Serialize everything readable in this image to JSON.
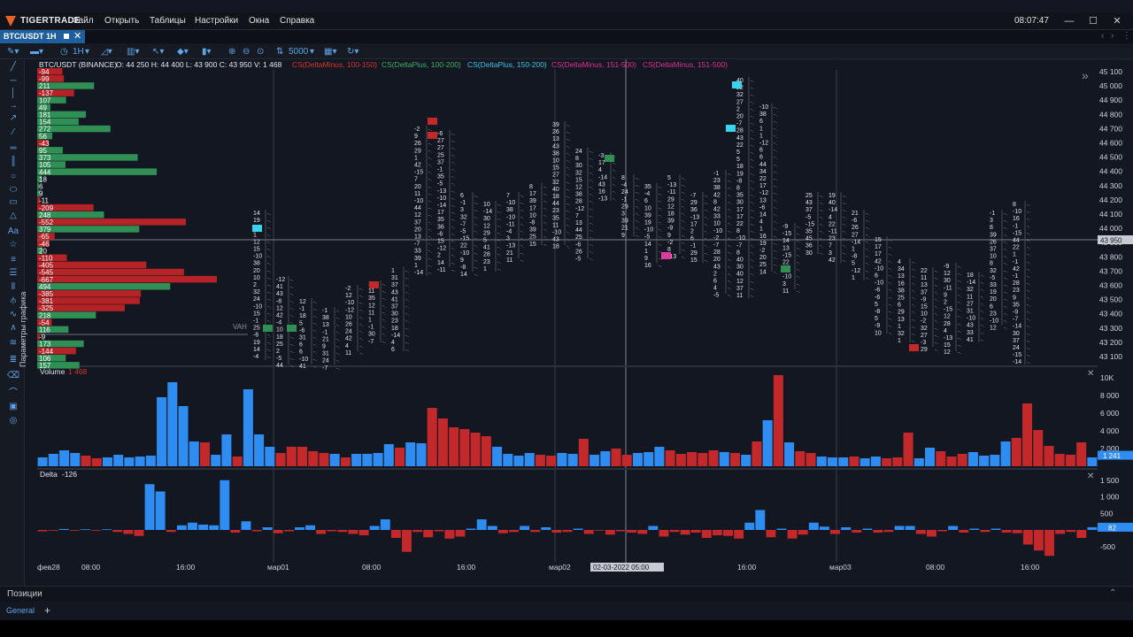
{
  "app": {
    "brand": "TIGERTRADE",
    "time": "08:07:47",
    "menu": [
      "Файл",
      "Открыть",
      "Таблицы",
      "Настройки",
      "Окна",
      "Справка"
    ]
  },
  "tab": {
    "label": "BTC/USDT 1H"
  },
  "toolbar": {
    "timeframe": "1H",
    "depth": "5000"
  },
  "side_label": "Параметры графика",
  "chart_header": {
    "symbol": "BTC/USDT (BINANCE)",
    "ohlc": "O: 44 250  H: 44 400  L: 43 900  C: 43 950  V: 1 468",
    "filters": [
      {
        "text": "CS(DeltaMinus, 100-150)",
        "color": "#d9342b"
      },
      {
        "text": "CS(DeltaPlus, 100-200)",
        "color": "#3fae61"
      },
      {
        "text": "CS(DeltaPlus, 150-200)",
        "color": "#39c4e0"
      },
      {
        "text": "CS(DeltaMinus, 151-500)",
        "color": "#e0308e"
      },
      {
        "text": "CS(DeltaMinus, 151-500)",
        "color": "#e0308e"
      }
    ]
  },
  "colors": {
    "up": "#2f8cf0",
    "down": "#c3282b",
    "profile_pos": "#2f8f54",
    "profile_neg": "#b62327",
    "cyan": "#3ad3ee",
    "magenta": "#e03a9c",
    "grid": "#2a2e38"
  },
  "price_axis": {
    "ticks": [
      "45 100",
      "45 000",
      "44 900",
      "44 800",
      "44 700",
      "44 600",
      "44 500",
      "44 400",
      "44 300",
      "44 200",
      "44 100",
      "44 000",
      "43 900",
      "43 800",
      "43 700",
      "43 600",
      "43 500",
      "43 400",
      "43 300",
      "43 200",
      "43 100"
    ],
    "current": "43 950"
  },
  "profile": {
    "label_vah": "VAH",
    "rows": [
      {
        "v": "-94"
      },
      {
        "v": "-99"
      },
      {
        "v": "211"
      },
      {
        "v": "-137"
      },
      {
        "v": "107"
      },
      {
        "v": "49"
      },
      {
        "v": "181"
      },
      {
        "v": "154"
      },
      {
        "v": "272"
      },
      {
        "v": "56"
      },
      {
        "v": "-43"
      },
      {
        "v": "95"
      },
      {
        "v": "373"
      },
      {
        "v": "105"
      },
      {
        "v": "444"
      },
      {
        "v": "18"
      },
      {
        "v": "6"
      },
      {
        "v": "9"
      },
      {
        "v": "-11"
      },
      {
        "v": "-209"
      },
      {
        "v": "248"
      },
      {
        "v": "-552"
      },
      {
        "v": "379"
      },
      {
        "v": "-65"
      },
      {
        "v": "-46"
      },
      {
        "v": "20"
      },
      {
        "v": "-110"
      },
      {
        "v": "-405"
      },
      {
        "v": "-545"
      },
      {
        "v": "-667"
      },
      {
        "v": "494"
      },
      {
        "v": "-385"
      },
      {
        "v": "-381"
      },
      {
        "v": "-325"
      },
      {
        "v": "218"
      },
      {
        "v": "-54"
      },
      {
        "v": "116"
      },
      {
        "v": "-9"
      },
      {
        "v": "173"
      },
      {
        "v": "-144"
      },
      {
        "v": "106"
      },
      {
        "v": "157"
      }
    ]
  },
  "volume_panel": {
    "label": "Volume",
    "value": "1 468",
    "ticks": [
      "10K",
      "8 000",
      "6 000",
      "4 000",
      "2 000"
    ],
    "current": "1 241",
    "bars": [
      {
        "v": 1000,
        "d": "u"
      },
      {
        "v": 1400,
        "d": "u"
      },
      {
        "v": 1800,
        "d": "u"
      },
      {
        "v": 1500,
        "d": "u"
      },
      {
        "v": 1200,
        "d": "d"
      },
      {
        "v": 900,
        "d": "d"
      },
      {
        "v": 1000,
        "d": "u"
      },
      {
        "v": 1300,
        "d": "u"
      },
      {
        "v": 1000,
        "d": "u"
      },
      {
        "v": 1100,
        "d": "u"
      },
      {
        "v": 1200,
        "d": "u"
      },
      {
        "v": 7800,
        "d": "u"
      },
      {
        "v": 9500,
        "d": "u"
      },
      {
        "v": 6800,
        "d": "u"
      },
      {
        "v": 2800,
        "d": "u"
      },
      {
        "v": 2700,
        "d": "d"
      },
      {
        "v": 1300,
        "d": "u"
      },
      {
        "v": 3600,
        "d": "u"
      },
      {
        "v": 1100,
        "d": "d"
      },
      {
        "v": 8700,
        "d": "u"
      },
      {
        "v": 3600,
        "d": "u"
      },
      {
        "v": 2200,
        "d": "u"
      },
      {
        "v": 1500,
        "d": "d"
      },
      {
        "v": 2200,
        "d": "d"
      },
      {
        "v": 2200,
        "d": "d"
      },
      {
        "v": 1700,
        "d": "d"
      },
      {
        "v": 1500,
        "d": "d"
      },
      {
        "v": 1400,
        "d": "u"
      },
      {
        "v": 1000,
        "d": "d"
      },
      {
        "v": 1400,
        "d": "u"
      },
      {
        "v": 1400,
        "d": "u"
      },
      {
        "v": 1500,
        "d": "u"
      },
      {
        "v": 2500,
        "d": "u"
      },
      {
        "v": 2100,
        "d": "d"
      },
      {
        "v": 2700,
        "d": "u"
      },
      {
        "v": 2600,
        "d": "u"
      },
      {
        "v": 6600,
        "d": "d"
      },
      {
        "v": 5400,
        "d": "d"
      },
      {
        "v": 4400,
        "d": "d"
      },
      {
        "v": 4200,
        "d": "d"
      },
      {
        "v": 3800,
        "d": "d"
      },
      {
        "v": 3400,
        "d": "d"
      },
      {
        "v": 2200,
        "d": "u"
      },
      {
        "v": 1400,
        "d": "u"
      },
      {
        "v": 1200,
        "d": "u"
      },
      {
        "v": 1500,
        "d": "u"
      },
      {
        "v": 1300,
        "d": "d"
      },
      {
        "v": 1200,
        "d": "d"
      },
      {
        "v": 1500,
        "d": "u"
      },
      {
        "v": 1400,
        "d": "u"
      },
      {
        "v": 3100,
        "d": "d"
      },
      {
        "v": 1300,
        "d": "u"
      },
      {
        "v": 1700,
        "d": "u"
      },
      {
        "v": 2000,
        "d": "d"
      },
      {
        "v": 1300,
        "d": "d"
      },
      {
        "v": 1500,
        "d": "u"
      },
      {
        "v": 1600,
        "d": "u"
      },
      {
        "v": 2200,
        "d": "u"
      },
      {
        "v": 1800,
        "d": "d"
      },
      {
        "v": 1400,
        "d": "d"
      },
      {
        "v": 1600,
        "d": "d"
      },
      {
        "v": 1500,
        "d": "d"
      },
      {
        "v": 1800,
        "d": "d"
      },
      {
        "v": 1600,
        "d": "u"
      },
      {
        "v": 1500,
        "d": "d"
      },
      {
        "v": 1300,
        "d": "u"
      },
      {
        "v": 2800,
        "d": "d"
      },
      {
        "v": 5200,
        "d": "u"
      },
      {
        "v": 10300,
        "d": "d"
      },
      {
        "v": 2700,
        "d": "u"
      },
      {
        "v": 1700,
        "d": "d"
      },
      {
        "v": 1500,
        "d": "d"
      },
      {
        "v": 1100,
        "d": "u"
      },
      {
        "v": 1000,
        "d": "u"
      },
      {
        "v": 1000,
        "d": "u"
      },
      {
        "v": 1100,
        "d": "d"
      },
      {
        "v": 900,
        "d": "u"
      },
      {
        "v": 1100,
        "d": "u"
      },
      {
        "v": 900,
        "d": "d"
      },
      {
        "v": 1000,
        "d": "d"
      },
      {
        "v": 3800,
        "d": "d"
      },
      {
        "v": 900,
        "d": "u"
      },
      {
        "v": 2100,
        "d": "u"
      },
      {
        "v": 1700,
        "d": "d"
      },
      {
        "v": 1100,
        "d": "d"
      },
      {
        "v": 1400,
        "d": "d"
      },
      {
        "v": 1600,
        "d": "u"
      },
      {
        "v": 1200,
        "d": "u"
      },
      {
        "v": 1300,
        "d": "u"
      },
      {
        "v": 2800,
        "d": "u"
      },
      {
        "v": 3200,
        "d": "d"
      },
      {
        "v": 7100,
        "d": "d"
      },
      {
        "v": 4100,
        "d": "d"
      },
      {
        "v": 2300,
        "d": "d"
      },
      {
        "v": 1400,
        "d": "d"
      },
      {
        "v": 1300,
        "d": "d"
      },
      {
        "v": 2700,
        "d": "d"
      },
      {
        "v": 1000,
        "d": "u"
      }
    ]
  },
  "delta_panel": {
    "label": "Delta",
    "value": "-126",
    "ticks": [
      "1 500",
      "1 000",
      "500",
      "-500"
    ],
    "current": "82",
    "bars": [
      -40,
      -20,
      30,
      -20,
      20,
      -20,
      20,
      -60,
      -120,
      -180,
      1380,
      1160,
      -60,
      140,
      220,
      160,
      140,
      1500,
      -80,
      260,
      -40,
      80,
      -100,
      -40,
      80,
      140,
      -120,
      -40,
      -60,
      -120,
      -160,
      120,
      320,
      -240,
      -660,
      -60,
      -220,
      -40,
      -260,
      -200,
      40,
      320,
      120,
      -100,
      -60,
      120,
      -60,
      80,
      -80,
      -60,
      40,
      -120,
      -20,
      -140,
      -40,
      -80,
      -120,
      120,
      -200,
      -60,
      -140,
      -80,
      -240,
      -160,
      -180,
      -260,
      220,
      600,
      -220,
      40,
      -260,
      -140,
      220,
      100,
      -120,
      80,
      -80,
      40,
      -80,
      -60,
      120,
      120,
      -120,
      -200,
      -40,
      120,
      -80,
      40,
      -60,
      40,
      -80,
      -100,
      -440,
      -620,
      -780,
      -120,
      -60,
      -240,
      82
    ]
  },
  "time_axis": {
    "labels": [
      "фев28",
      "08:00",
      "16:00",
      "мар01",
      "08:00",
      "16:00",
      "мар02",
      "16:00",
      "мар03",
      "08:00",
      "16:00"
    ],
    "crosshair": "02-03-2022 05:00"
  },
  "bottom": {
    "positions": "Позиции",
    "general": "General",
    "plus": "+"
  }
}
